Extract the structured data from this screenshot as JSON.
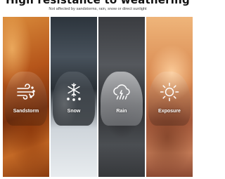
{
  "header": {
    "title": "High resistance to weathering",
    "subtitle": "Not affected by sandstorms, rain, snow or direct sunlight"
  },
  "panels": [
    {
      "label": "Sandstorm",
      "icon": "wind-icon"
    },
    {
      "label": "Snow",
      "icon": "snowflake-icon"
    },
    {
      "label": "Rain",
      "icon": "rain-cloud-icon"
    },
    {
      "label": "Exposure",
      "icon": "sun-icon"
    }
  ]
}
